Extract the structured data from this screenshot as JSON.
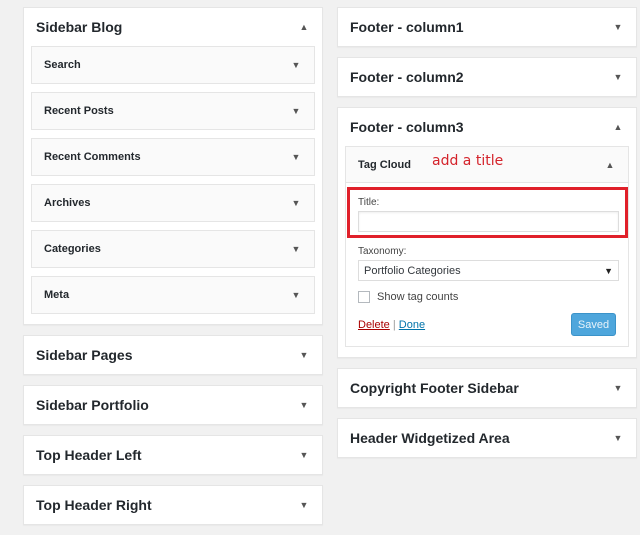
{
  "left_sidebars": [
    {
      "title": "Sidebar Blog",
      "caret": "▲",
      "widgets": [
        {
          "title": "Search",
          "caret": "▼"
        },
        {
          "title": "Recent Posts",
          "caret": "▼"
        },
        {
          "title": "Recent Comments",
          "caret": "▼"
        },
        {
          "title": "Archives",
          "caret": "▼"
        },
        {
          "title": "Categories",
          "caret": "▼"
        },
        {
          "title": "Meta",
          "caret": "▼"
        }
      ]
    },
    {
      "title": "Sidebar Pages",
      "caret": "▼"
    },
    {
      "title": "Sidebar Portfolio",
      "caret": "▼"
    },
    {
      "title": "Top Header Left",
      "caret": "▼"
    },
    {
      "title": "Top Header Right",
      "caret": "▼"
    }
  ],
  "right_sidebars": [
    {
      "title": "Footer - column1",
      "caret": "▼"
    },
    {
      "title": "Footer - column2",
      "caret": "▼"
    },
    {
      "title": "Footer - column3",
      "caret": "▲",
      "open_widget": {
        "title": "Tag Cloud",
        "caret": "▲",
        "annotation": "add a title",
        "title_label": "Title:",
        "title_value": "",
        "taxonomy_label": "Taxonomy:",
        "taxonomy_selected": "Portfolio Categories",
        "taxonomy_arrow": "▼",
        "show_counts_label": "Show tag counts",
        "show_counts_checked": false,
        "delete_label": "Delete",
        "separator": "|",
        "done_label": "Done",
        "saved_label": "Saved"
      }
    },
    {
      "title": "Copyright Footer Sidebar",
      "caret": "▼"
    },
    {
      "title": "Header Widgetized Area",
      "caret": "▼"
    }
  ],
  "colors": {
    "annotation": "#d4232b",
    "highlight_border": "#e0202a",
    "saved_button": "#4ea6dc",
    "delete_link": "#aa0000",
    "done_link": "#0073aa"
  }
}
